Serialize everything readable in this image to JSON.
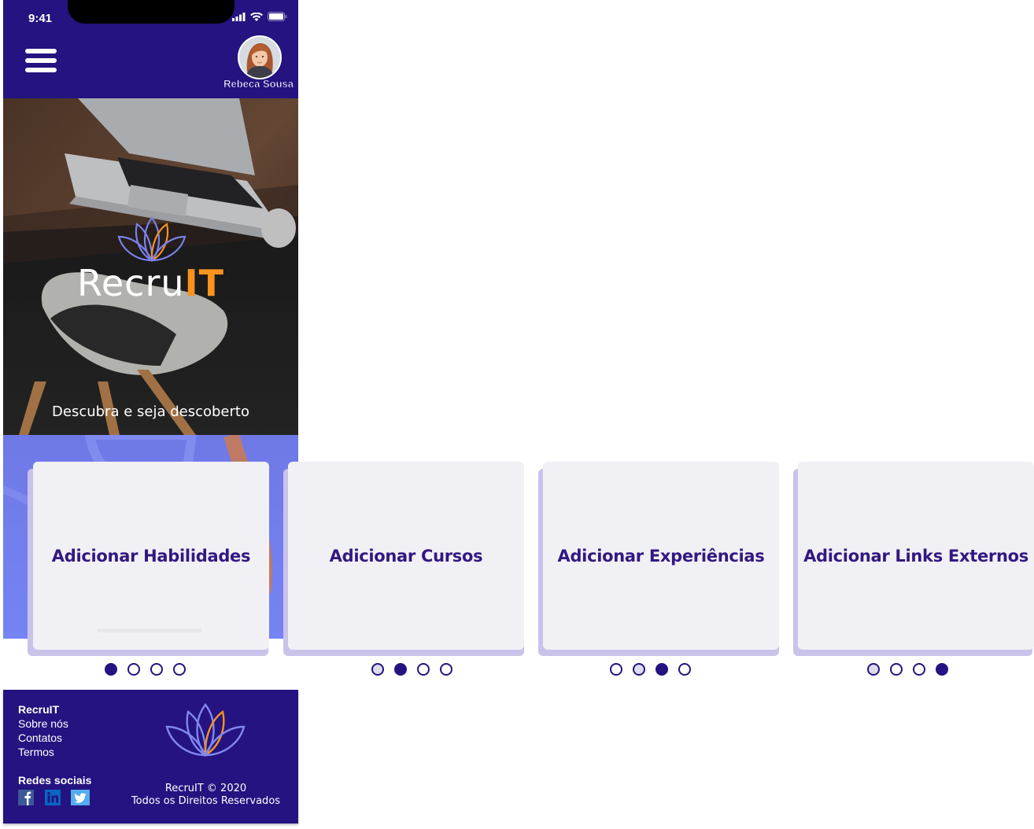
{
  "status_bar": {
    "time": "9:41"
  },
  "header": {
    "user_name": "Rebeca Sousa",
    "menu_icon": "hamburger-menu-icon",
    "avatar_icon": "user-avatar"
  },
  "hero": {
    "brand_prefix": "Recru",
    "brand_suffix": "IT",
    "tagline": "Descubra e seja descoberto"
  },
  "cards": [
    {
      "title": "Adicionar Habilidades"
    },
    {
      "title": "Adicionar Cursos"
    },
    {
      "title": "Adicionar Experiências"
    },
    {
      "title": "Adicionar Links Externos"
    }
  ],
  "footer": {
    "links": [
      "RecruIT",
      "Sobre nós",
      "Contatos",
      "Termos"
    ],
    "social_heading": "Redes sociais",
    "social_icons": [
      "facebook-icon",
      "linkedin-icon",
      "twitter-icon"
    ],
    "copyright_line1": "RecruIT © 2020",
    "copyright_line2": "Todos os Direitos Reservados"
  },
  "colors": {
    "primary": "#241380",
    "accent": "#f7931e",
    "card_bg": "#f1f1f5",
    "card_text": "#331882",
    "gradient": "#7583f3"
  }
}
